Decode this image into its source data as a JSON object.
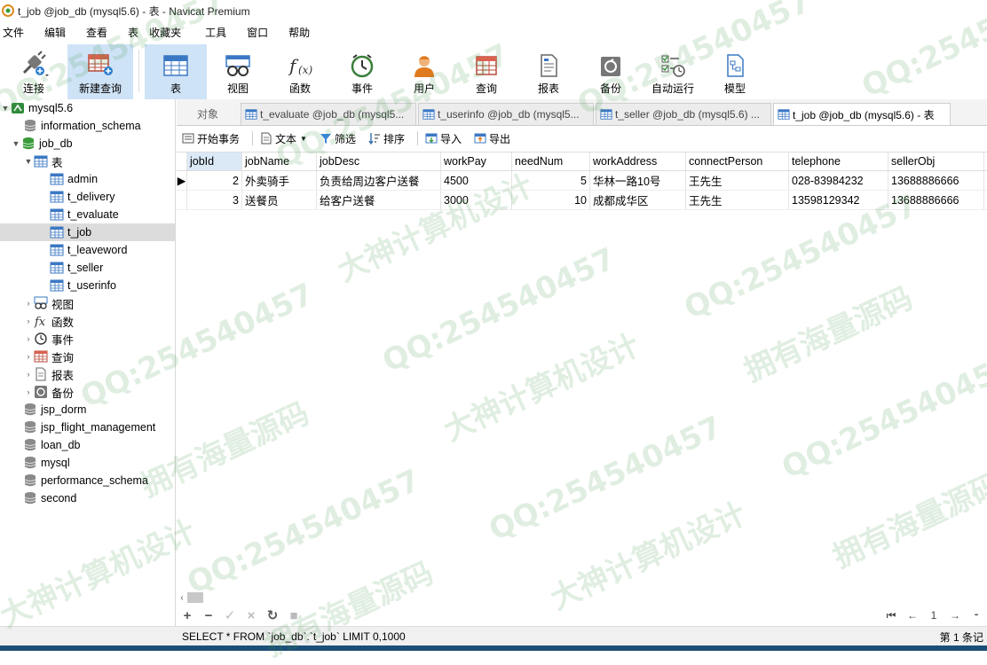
{
  "window": {
    "title": "t_job @job_db (mysql5.6) - 表 - Navicat Premium"
  },
  "menu": [
    "文件",
    "编辑",
    "查看",
    "表",
    "收藏夹",
    "工具",
    "窗口",
    "帮助"
  ],
  "toolbar": {
    "connect": "连接",
    "new_query": "新建查询",
    "table": "表",
    "view": "视图",
    "function": "函数",
    "event": "事件",
    "user": "用户",
    "query": "查询",
    "report": "报表",
    "backup": "备份",
    "autorun": "自动运行",
    "model": "模型"
  },
  "tree": {
    "connection": "mysql5.6",
    "db_information_schema": "information_schema",
    "db_job": "job_db",
    "tables_folder": "表",
    "tables": [
      "admin",
      "t_delivery",
      "t_evaluate",
      "t_job",
      "t_leaveword",
      "t_seller",
      "t_userinfo"
    ],
    "views": "视图",
    "functions": "函数",
    "events": "事件",
    "queries": "查询",
    "reports": "报表",
    "backups": "备份",
    "other_dbs": [
      "jsp_dorm",
      "jsp_flight_management",
      "loan_db",
      "mysql",
      "performance_schema",
      "second"
    ]
  },
  "tabs": {
    "objects": "对象",
    "t_evaluate": "t_evaluate @job_db (mysql5...",
    "t_userinfo": "t_userinfo @job_db (mysql5...",
    "t_seller": "t_seller @job_db (mysql5.6) ...",
    "t_job": "t_job @job_db (mysql5.6) - 表"
  },
  "actions": {
    "begin_tx": "开始事务",
    "text": "文本",
    "filter": "筛选",
    "sort": "排序",
    "import": "导入",
    "export": "导出"
  },
  "grid": {
    "columns": [
      "jobId",
      "jobName",
      "jobDesc",
      "workPay",
      "needNum",
      "workAddress",
      "connectPerson",
      "telephone",
      "sellerObj"
    ],
    "rows": [
      [
        "2",
        "外卖骑手",
        "负责给周边客户送餐",
        "4500",
        "5",
        "华林一路10号",
        "王先生",
        "028-83984232",
        "13688886666"
      ],
      [
        "3",
        "送餐员",
        "给客户送餐",
        "3000",
        "10",
        "成都成华区",
        "王先生",
        "13598129342",
        "13688886666"
      ]
    ]
  },
  "pager": {
    "page": "1"
  },
  "status": {
    "sql": "SELECT * FROM `job_db`.`t_job` LIMIT 0,1000",
    "records": "第 1 条记"
  },
  "watermarks": [
    "QQ:254540457",
    "大神计算机设计",
    "拥有海量源码"
  ],
  "colors": {
    "selected_tab": "#cfe3f7",
    "db_green": "#3a9a3a",
    "table_blue": "#3b78c4",
    "status_bg": "#f0f0f0"
  }
}
